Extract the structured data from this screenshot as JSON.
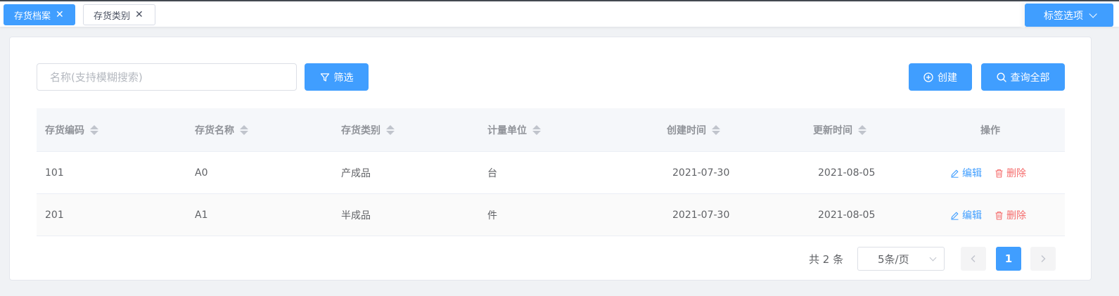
{
  "tabs": [
    {
      "label": "存货档案",
      "active": true
    },
    {
      "label": "存货类别",
      "active": false
    }
  ],
  "tab_options_label": "标签选项",
  "search": {
    "placeholder": "名称(支持模糊搜索)",
    "value": ""
  },
  "toolbar": {
    "filter_label": "筛选",
    "create_label": "创建",
    "query_all_label": "查询全部"
  },
  "table": {
    "columns": [
      "存货编码",
      "存货名称",
      "存货类别",
      "计量单位",
      "创建时间",
      "更新时间",
      "操作"
    ],
    "rows": [
      {
        "code": "101",
        "name": "A0",
        "category": "产成品",
        "unit": "台",
        "created": "2021-07-30",
        "updated": "2021-08-05"
      },
      {
        "code": "201",
        "name": "A1",
        "category": "半成品",
        "unit": "件",
        "created": "2021-07-30",
        "updated": "2021-08-05"
      }
    ],
    "edit_label": "编辑",
    "delete_label": "删除"
  },
  "pagination": {
    "total_text": "共 2 条",
    "page_size": "5条/页",
    "current_page": "1"
  },
  "colors": {
    "primary": "#409eff",
    "danger": "#f56c6c"
  }
}
